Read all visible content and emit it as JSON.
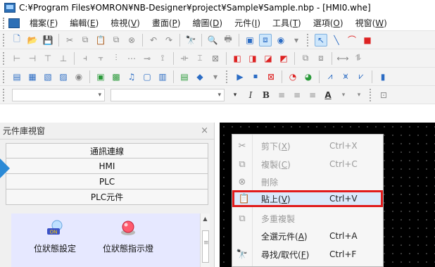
{
  "title": "C:¥Program Files¥OMRON¥NB-Designer¥project¥Sample¥Sample.nbp - [HMI0.whe]",
  "menu": [
    {
      "label": "檔案(",
      "key": "F",
      "end": ")"
    },
    {
      "label": "編輯(",
      "key": "E",
      "end": ")"
    },
    {
      "label": "檢視(",
      "key": "V",
      "end": ")"
    },
    {
      "label": "畫面(",
      "key": "P",
      "end": ")"
    },
    {
      "label": "繪圖(",
      "key": "D",
      "end": ")"
    },
    {
      "label": "元件(",
      "key": "I",
      "end": ")"
    },
    {
      "label": "工具(",
      "key": "T",
      "end": ")"
    },
    {
      "label": "選項(",
      "key": "O",
      "end": ")"
    },
    {
      "label": "視窗(",
      "key": "W",
      "end": ")"
    }
  ],
  "format_toolbar": {
    "italic": "I",
    "bold": "B",
    "font_color": "A"
  },
  "component_panel": {
    "title": "元件庫視窗",
    "close": "×",
    "categories": [
      "通訊連線",
      "HMI",
      "PLC",
      "PLC元件"
    ],
    "gallery": [
      {
        "label": "位狀態設定",
        "icon": "bit-set-icon",
        "badge": "ON"
      },
      {
        "label": "位狀態指示燈",
        "icon": "bit-lamp-icon"
      }
    ]
  },
  "context_menu": {
    "items": [
      {
        "label": "剪下(",
        "key": "X",
        "end": ")",
        "shortcut": "Ctrl+X",
        "icon": "cut-icon",
        "enabled": false
      },
      {
        "label": "複製(",
        "key": "C",
        "end": ")",
        "shortcut": "Ctrl+C",
        "icon": "copy-icon",
        "enabled": false
      },
      {
        "label": "刪除",
        "key": "",
        "end": "",
        "shortcut": "",
        "icon": "delete-icon",
        "enabled": false
      },
      {
        "label": "貼上(",
        "key": "V",
        "end": ")",
        "shortcut": "Ctrl+V",
        "icon": "paste-icon",
        "enabled": true,
        "highlighted": true
      },
      {
        "label": "多重複製",
        "key": "",
        "end": "",
        "shortcut": "",
        "icon": "multi-copy-icon",
        "enabled": false
      },
      {
        "label": "全選元件(",
        "key": "A",
        "end": ")",
        "shortcut": "Ctrl+A",
        "icon": "",
        "enabled": true
      },
      {
        "label": "尋找/取代(",
        "key": "F",
        "end": ")",
        "shortcut": "Ctrl+F",
        "icon": "find-icon",
        "enabled": true
      }
    ],
    "highlight_color": "#e11b1b"
  },
  "colors": {
    "canvas": "#000000",
    "gallery_bg": "#e6e8ff",
    "accent": "#2b8ad6"
  }
}
